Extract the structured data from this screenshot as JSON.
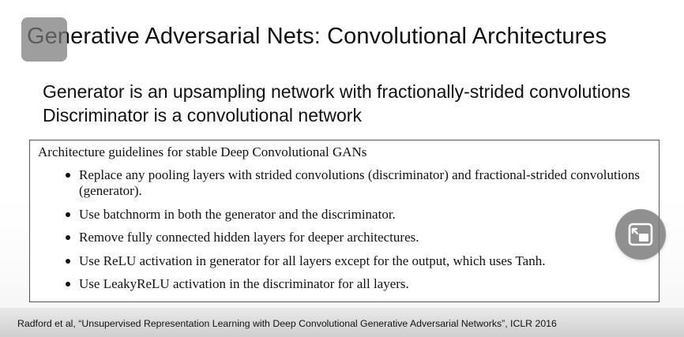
{
  "slide": {
    "title": "Generative Adversarial Nets: Convolutional Architectures",
    "subtitle_lines": [
      "Generator is an upsampling network with fractionally-strided convolutions",
      "Discriminator is a convolutional network"
    ],
    "box": {
      "heading": "Architecture guidelines for stable Deep Convolutional GANs",
      "bullets": [
        "Replace any pooling layers with strided convolutions (discriminator) and fractional-strided convolutions (generator).",
        "Use batchnorm in both the generator and the discriminator.",
        "Remove fully connected hidden layers for deeper architectures.",
        "Use ReLU activation in generator for all layers except for the output, which uses Tanh.",
        "Use LeakyReLU activation in the discriminator for all layers."
      ]
    },
    "citation": "Radford et al, “Unsupervised Representation Learning with Deep Convolutional Generative Adversarial Networks”, ICLR 2016"
  },
  "overlay": {
    "pip_button_icon": "picture-in-picture-icon",
    "corner_button_icon": "overlay-button"
  }
}
